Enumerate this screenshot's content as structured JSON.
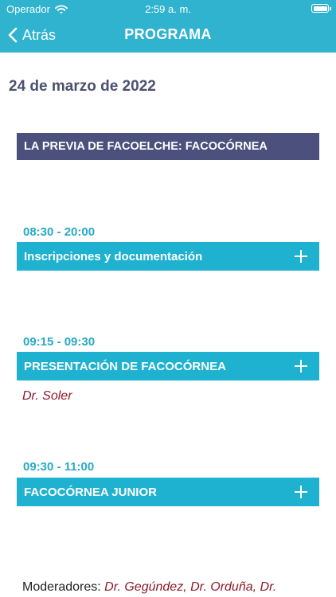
{
  "status_bar": {
    "carrier": "Operador",
    "time": "2:59 a. m."
  },
  "nav": {
    "back_label": "Atrás",
    "title": "PROGRAMA"
  },
  "date": "24 de marzo de 2022",
  "section": {
    "title": "LA PREVIA DE FACOELCHE: FACOCÓRNEA"
  },
  "sessions": [
    {
      "time": "08:30 - 20:00",
      "title": "Inscripciones y documentación",
      "speaker": ""
    },
    {
      "time": "09:15 - 09:30",
      "title": "PRESENTACIÓN DE FACOCÓRNEA",
      "speaker": "Dr. Soler"
    },
    {
      "time": "09:30 - 11:00",
      "title": "FACOCÓRNEA JUNIOR",
      "speaker": ""
    }
  ],
  "moderators": {
    "label": "Moderadores:",
    "names": "Dr. Gegúndez, Dr. Orduña, Dr."
  },
  "colors": {
    "header": "#2fb3cf",
    "section": "#4c507c",
    "session": "#1fb2d0",
    "speaker": "#8c1a2a"
  }
}
